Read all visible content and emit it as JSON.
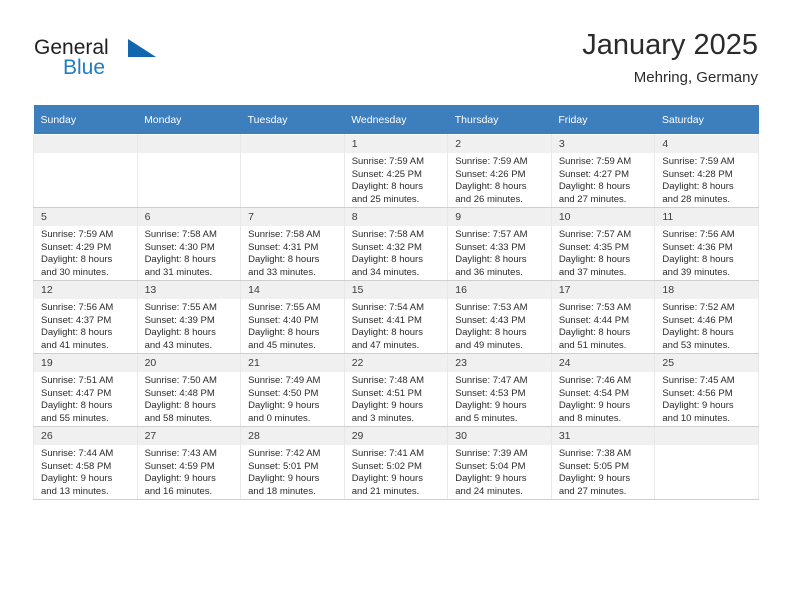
{
  "brand": {
    "word_one": "General",
    "word_two": "Blue",
    "accent_color": "#1166ad",
    "text_color": "#231f20"
  },
  "header": {
    "title": "January 2025",
    "subtitle": "Mehring, Germany"
  },
  "calendar": {
    "header_bg": "#3d7ebd",
    "daynum_bg": "#f0f0f0",
    "weekdays": [
      "Sunday",
      "Monday",
      "Tuesday",
      "Wednesday",
      "Thursday",
      "Friday",
      "Saturday"
    ],
    "weeks": [
      [
        {
          "day": "",
          "sunrise": "",
          "sunset": "",
          "daylight_a": "",
          "daylight_b": ""
        },
        {
          "day": "",
          "sunrise": "",
          "sunset": "",
          "daylight_a": "",
          "daylight_b": ""
        },
        {
          "day": "",
          "sunrise": "",
          "sunset": "",
          "daylight_a": "",
          "daylight_b": ""
        },
        {
          "day": "1",
          "sunrise": "Sunrise: 7:59 AM",
          "sunset": "Sunset: 4:25 PM",
          "daylight_a": "Daylight: 8 hours",
          "daylight_b": "and 25 minutes."
        },
        {
          "day": "2",
          "sunrise": "Sunrise: 7:59 AM",
          "sunset": "Sunset: 4:26 PM",
          "daylight_a": "Daylight: 8 hours",
          "daylight_b": "and 26 minutes."
        },
        {
          "day": "3",
          "sunrise": "Sunrise: 7:59 AM",
          "sunset": "Sunset: 4:27 PM",
          "daylight_a": "Daylight: 8 hours",
          "daylight_b": "and 27 minutes."
        },
        {
          "day": "4",
          "sunrise": "Sunrise: 7:59 AM",
          "sunset": "Sunset: 4:28 PM",
          "daylight_a": "Daylight: 8 hours",
          "daylight_b": "and 28 minutes."
        }
      ],
      [
        {
          "day": "5",
          "sunrise": "Sunrise: 7:59 AM",
          "sunset": "Sunset: 4:29 PM",
          "daylight_a": "Daylight: 8 hours",
          "daylight_b": "and 30 minutes."
        },
        {
          "day": "6",
          "sunrise": "Sunrise: 7:58 AM",
          "sunset": "Sunset: 4:30 PM",
          "daylight_a": "Daylight: 8 hours",
          "daylight_b": "and 31 minutes."
        },
        {
          "day": "7",
          "sunrise": "Sunrise: 7:58 AM",
          "sunset": "Sunset: 4:31 PM",
          "daylight_a": "Daylight: 8 hours",
          "daylight_b": "and 33 minutes."
        },
        {
          "day": "8",
          "sunrise": "Sunrise: 7:58 AM",
          "sunset": "Sunset: 4:32 PM",
          "daylight_a": "Daylight: 8 hours",
          "daylight_b": "and 34 minutes."
        },
        {
          "day": "9",
          "sunrise": "Sunrise: 7:57 AM",
          "sunset": "Sunset: 4:33 PM",
          "daylight_a": "Daylight: 8 hours",
          "daylight_b": "and 36 minutes."
        },
        {
          "day": "10",
          "sunrise": "Sunrise: 7:57 AM",
          "sunset": "Sunset: 4:35 PM",
          "daylight_a": "Daylight: 8 hours",
          "daylight_b": "and 37 minutes."
        },
        {
          "day": "11",
          "sunrise": "Sunrise: 7:56 AM",
          "sunset": "Sunset: 4:36 PM",
          "daylight_a": "Daylight: 8 hours",
          "daylight_b": "and 39 minutes."
        }
      ],
      [
        {
          "day": "12",
          "sunrise": "Sunrise: 7:56 AM",
          "sunset": "Sunset: 4:37 PM",
          "daylight_a": "Daylight: 8 hours",
          "daylight_b": "and 41 minutes."
        },
        {
          "day": "13",
          "sunrise": "Sunrise: 7:55 AM",
          "sunset": "Sunset: 4:39 PM",
          "daylight_a": "Daylight: 8 hours",
          "daylight_b": "and 43 minutes."
        },
        {
          "day": "14",
          "sunrise": "Sunrise: 7:55 AM",
          "sunset": "Sunset: 4:40 PM",
          "daylight_a": "Daylight: 8 hours",
          "daylight_b": "and 45 minutes."
        },
        {
          "day": "15",
          "sunrise": "Sunrise: 7:54 AM",
          "sunset": "Sunset: 4:41 PM",
          "daylight_a": "Daylight: 8 hours",
          "daylight_b": "and 47 minutes."
        },
        {
          "day": "16",
          "sunrise": "Sunrise: 7:53 AM",
          "sunset": "Sunset: 4:43 PM",
          "daylight_a": "Daylight: 8 hours",
          "daylight_b": "and 49 minutes."
        },
        {
          "day": "17",
          "sunrise": "Sunrise: 7:53 AM",
          "sunset": "Sunset: 4:44 PM",
          "daylight_a": "Daylight: 8 hours",
          "daylight_b": "and 51 minutes."
        },
        {
          "day": "18",
          "sunrise": "Sunrise: 7:52 AM",
          "sunset": "Sunset: 4:46 PM",
          "daylight_a": "Daylight: 8 hours",
          "daylight_b": "and 53 minutes."
        }
      ],
      [
        {
          "day": "19",
          "sunrise": "Sunrise: 7:51 AM",
          "sunset": "Sunset: 4:47 PM",
          "daylight_a": "Daylight: 8 hours",
          "daylight_b": "and 55 minutes."
        },
        {
          "day": "20",
          "sunrise": "Sunrise: 7:50 AM",
          "sunset": "Sunset: 4:48 PM",
          "daylight_a": "Daylight: 8 hours",
          "daylight_b": "and 58 minutes."
        },
        {
          "day": "21",
          "sunrise": "Sunrise: 7:49 AM",
          "sunset": "Sunset: 4:50 PM",
          "daylight_a": "Daylight: 9 hours",
          "daylight_b": "and 0 minutes."
        },
        {
          "day": "22",
          "sunrise": "Sunrise: 7:48 AM",
          "sunset": "Sunset: 4:51 PM",
          "daylight_a": "Daylight: 9 hours",
          "daylight_b": "and 3 minutes."
        },
        {
          "day": "23",
          "sunrise": "Sunrise: 7:47 AM",
          "sunset": "Sunset: 4:53 PM",
          "daylight_a": "Daylight: 9 hours",
          "daylight_b": "and 5 minutes."
        },
        {
          "day": "24",
          "sunrise": "Sunrise: 7:46 AM",
          "sunset": "Sunset: 4:54 PM",
          "daylight_a": "Daylight: 9 hours",
          "daylight_b": "and 8 minutes."
        },
        {
          "day": "25",
          "sunrise": "Sunrise: 7:45 AM",
          "sunset": "Sunset: 4:56 PM",
          "daylight_a": "Daylight: 9 hours",
          "daylight_b": "and 10 minutes."
        }
      ],
      [
        {
          "day": "26",
          "sunrise": "Sunrise: 7:44 AM",
          "sunset": "Sunset: 4:58 PM",
          "daylight_a": "Daylight: 9 hours",
          "daylight_b": "and 13 minutes."
        },
        {
          "day": "27",
          "sunrise": "Sunrise: 7:43 AM",
          "sunset": "Sunset: 4:59 PM",
          "daylight_a": "Daylight: 9 hours",
          "daylight_b": "and 16 minutes."
        },
        {
          "day": "28",
          "sunrise": "Sunrise: 7:42 AM",
          "sunset": "Sunset: 5:01 PM",
          "daylight_a": "Daylight: 9 hours",
          "daylight_b": "and 18 minutes."
        },
        {
          "day": "29",
          "sunrise": "Sunrise: 7:41 AM",
          "sunset": "Sunset: 5:02 PM",
          "daylight_a": "Daylight: 9 hours",
          "daylight_b": "and 21 minutes."
        },
        {
          "day": "30",
          "sunrise": "Sunrise: 7:39 AM",
          "sunset": "Sunset: 5:04 PM",
          "daylight_a": "Daylight: 9 hours",
          "daylight_b": "and 24 minutes."
        },
        {
          "day": "31",
          "sunrise": "Sunrise: 7:38 AM",
          "sunset": "Sunset: 5:05 PM",
          "daylight_a": "Daylight: 9 hours",
          "daylight_b": "and 27 minutes."
        },
        {
          "day": "",
          "sunrise": "",
          "sunset": "",
          "daylight_a": "",
          "daylight_b": ""
        }
      ]
    ]
  }
}
